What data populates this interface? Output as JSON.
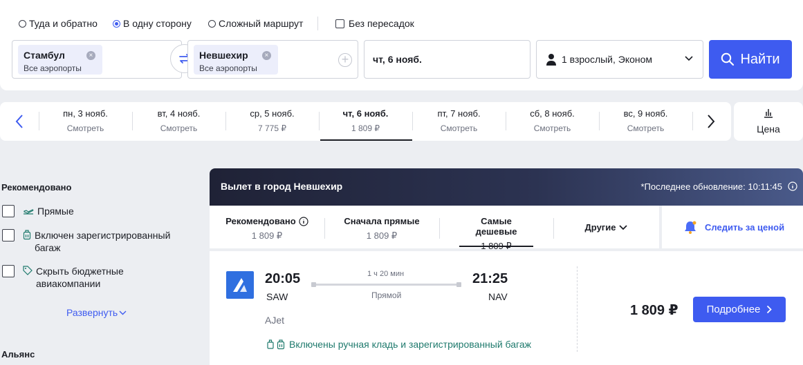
{
  "colors": {
    "accent": "#3e5bf0",
    "baggage": "#1f7a6d",
    "muted": "#6b6f7d",
    "text": "#1b1d24"
  },
  "search": {
    "trip_types": [
      {
        "label": "Туда и обратно",
        "selected": false
      },
      {
        "label": "В одну сторону",
        "selected": true
      },
      {
        "label": "Сложный маршрут",
        "selected": false
      }
    ],
    "nonstop_label": "Без пересадок",
    "origin": {
      "city": "Стамбул",
      "sub": "Все аэропорты"
    },
    "destination": {
      "city": "Невшехир",
      "sub": "Все аэропорты"
    },
    "date": "чт, 6 нояб.",
    "passengers": "1 взрослый, Эконом",
    "find_label": "Найти"
  },
  "date_strip": {
    "days": [
      {
        "date": "пн, 3 нояб.",
        "price": "Смотреть",
        "active": false
      },
      {
        "date": "вт, 4 нояб.",
        "price": "Смотреть",
        "active": false
      },
      {
        "date": "ср, 5 нояб.",
        "price": "7 775 ₽",
        "active": false
      },
      {
        "date": "чт, 6 нояб.",
        "price": "1 809 ₽",
        "active": true
      },
      {
        "date": "пт, 7 нояб.",
        "price": "Смотреть",
        "active": false
      },
      {
        "date": "сб, 8 нояб.",
        "price": "Смотреть",
        "active": false
      },
      {
        "date": "вс, 9 нояб.",
        "price": "Смотреть",
        "active": false
      }
    ],
    "price_chart_label": "Цена"
  },
  "filters": {
    "recommended_title": "Рекомендовано",
    "items": [
      {
        "label": "Прямые",
        "icon": "plane-icon"
      },
      {
        "label": "Включен зарегистрированный багаж",
        "icon": "luggage-icon"
      },
      {
        "label": "Скрыть бюджетные авиакомпании",
        "icon": "tag-icon"
      }
    ],
    "expand_label": "Развернуть",
    "alliance_title": "Альянс"
  },
  "results": {
    "header_title": "Вылет в город Невшехир",
    "last_update": "*Последнее обновление: 10:11:45",
    "sort_tabs": [
      {
        "label": "Рекомендовано",
        "value": "1 809 ₽",
        "active": false,
        "info": true
      },
      {
        "label": "Сначала прямые",
        "value": "1 809 ₽",
        "active": false
      },
      {
        "label": "Самые дешевые",
        "value": "1 809 ₽",
        "active": true
      },
      {
        "label": "Другие",
        "value": "",
        "active": false,
        "dropdown": true
      }
    ],
    "watch_price_label": "Следить за ценой",
    "flight": {
      "dep_time": "20:05",
      "dep_code": "SAW",
      "arr_time": "21:25",
      "arr_code": "NAV",
      "duration": "1 ч 20 мин",
      "stops": "Прямой",
      "airline": "AJet",
      "baggage": "Включены ручная кладь и зарегистрированный багаж",
      "price": "1 809 ₽",
      "details_label": "Подробнее"
    }
  }
}
